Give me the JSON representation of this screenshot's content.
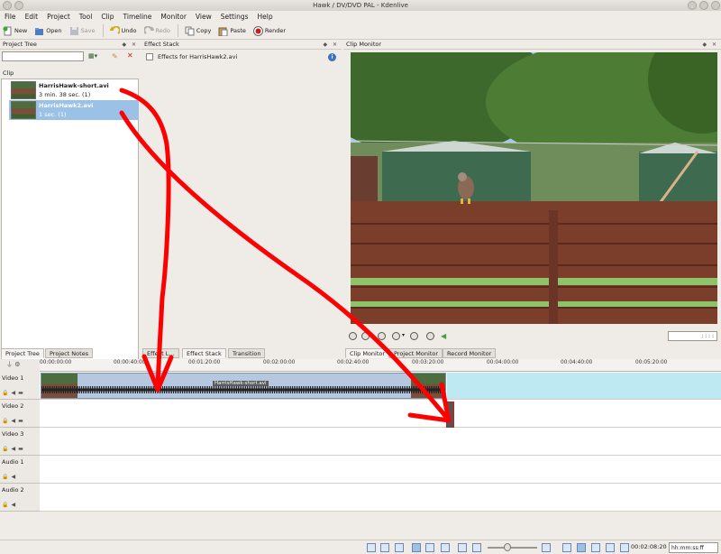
{
  "window": {
    "title": "Hawk / DV/DVD PAL - Kdenlive"
  },
  "menubar": [
    "File",
    "Edit",
    "Project",
    "Tool",
    "Clip",
    "Timeline",
    "Monitor",
    "View",
    "Settings",
    "Help"
  ],
  "toolbar": {
    "new": "New",
    "open": "Open",
    "save": "Save",
    "undo": "Undo",
    "redo": "Redo",
    "copy": "Copy",
    "paste": "Paste",
    "render": "Render"
  },
  "project_tree": {
    "title": "Project Tree",
    "search_value": "",
    "column": "Clip",
    "clips": [
      {
        "name": "HarrisHawk-short.avi",
        "info": "3 min. 38 sec. (1)"
      },
      {
        "name": "HarrisHawk2.avi",
        "info": "1 sec. (1)"
      }
    ]
  },
  "effect_stack": {
    "title": "Effect Stack",
    "effects_for": "Effects for HarrisHawk2.avi"
  },
  "clip_monitor": {
    "title": "Clip Monitor",
    "timecode": ": : : :"
  },
  "tabs_left": [
    "Project Tree",
    "Project Notes"
  ],
  "tabs_mid": [
    "Effect L...",
    "Effect Stack",
    "Transition"
  ],
  "tabs_right": [
    "Clip Monitor",
    "Project Monitor",
    "Record Monitor"
  ],
  "timeline": {
    "ruler": [
      "00:00:00:00",
      "00:00:40:00",
      "00:01:20:00",
      "00:02:00:00",
      "00:02:40:00",
      "00:03:20:00",
      "00:04:00:00",
      "00:04:40:00",
      "00:05:20:00"
    ],
    "tracks": [
      "Video 1",
      "Video 2",
      "Video 3",
      "Audio 1",
      "Audio 2"
    ],
    "clip_label": "HarrisHawk-short.avi"
  },
  "statusbar": {
    "timecode": "00:02:08:20",
    "format": "hh:mm:ss:ff"
  },
  "colors": {
    "annotation": "#ff0000",
    "selection": "#9bc2e6",
    "clip": "#b5c8e0"
  }
}
